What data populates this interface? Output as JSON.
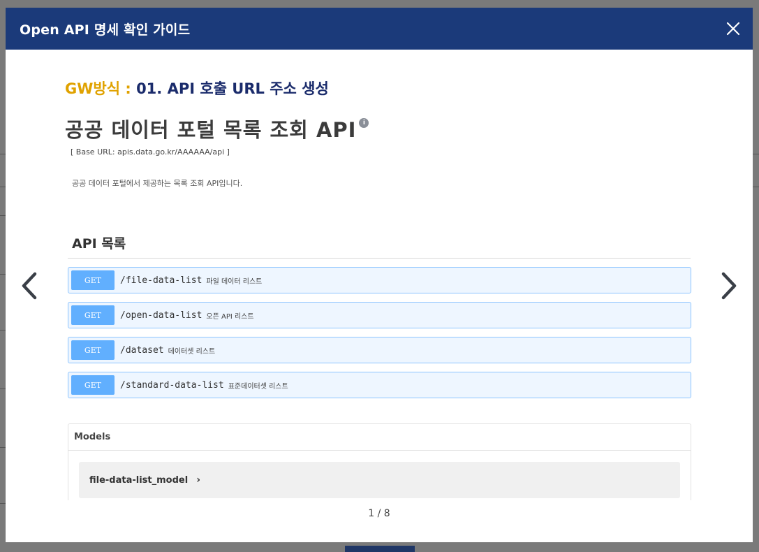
{
  "modal": {
    "title": "Open API 명세 확인 가이드"
  },
  "slide": {
    "step_prefix": "GW방식 : ",
    "step_text": "01. API 호출 URL 주소 생성",
    "api_title": "공공 데이터 포털 목록 조회 API",
    "info_badge": "i",
    "base_url": "[ Base URL: apis.data.go.kr/AAAAAA/api ]",
    "description": "공공 데이터 포털에서 제공하는 목록 조회 API입니다.",
    "api_list_title": "API 목록",
    "endpoints": [
      {
        "method": "GET",
        "path": "/file-data-list",
        "desc": "파일 데이터 리스트"
      },
      {
        "method": "GET",
        "path": "/open-data-list",
        "desc": "오픈 API 리스트"
      },
      {
        "method": "GET",
        "path": "/dataset",
        "desc": "데이터셋 리스트"
      },
      {
        "method": "GET",
        "path": "/standard-data-list",
        "desc": "표준데이터셋 리스트"
      }
    ],
    "models_title": "Models",
    "models": [
      {
        "name": "file-data-list_model",
        "chevron": "›"
      }
    ]
  },
  "pager": {
    "text": "1 / 8"
  },
  "colors": {
    "header_bg": "#1b3a7a",
    "gw_accent": "#e0a200",
    "get_badge": "#61affe"
  },
  "icons": {
    "close": "close-icon",
    "prev": "chevron-left-icon",
    "next": "chevron-right-icon"
  }
}
